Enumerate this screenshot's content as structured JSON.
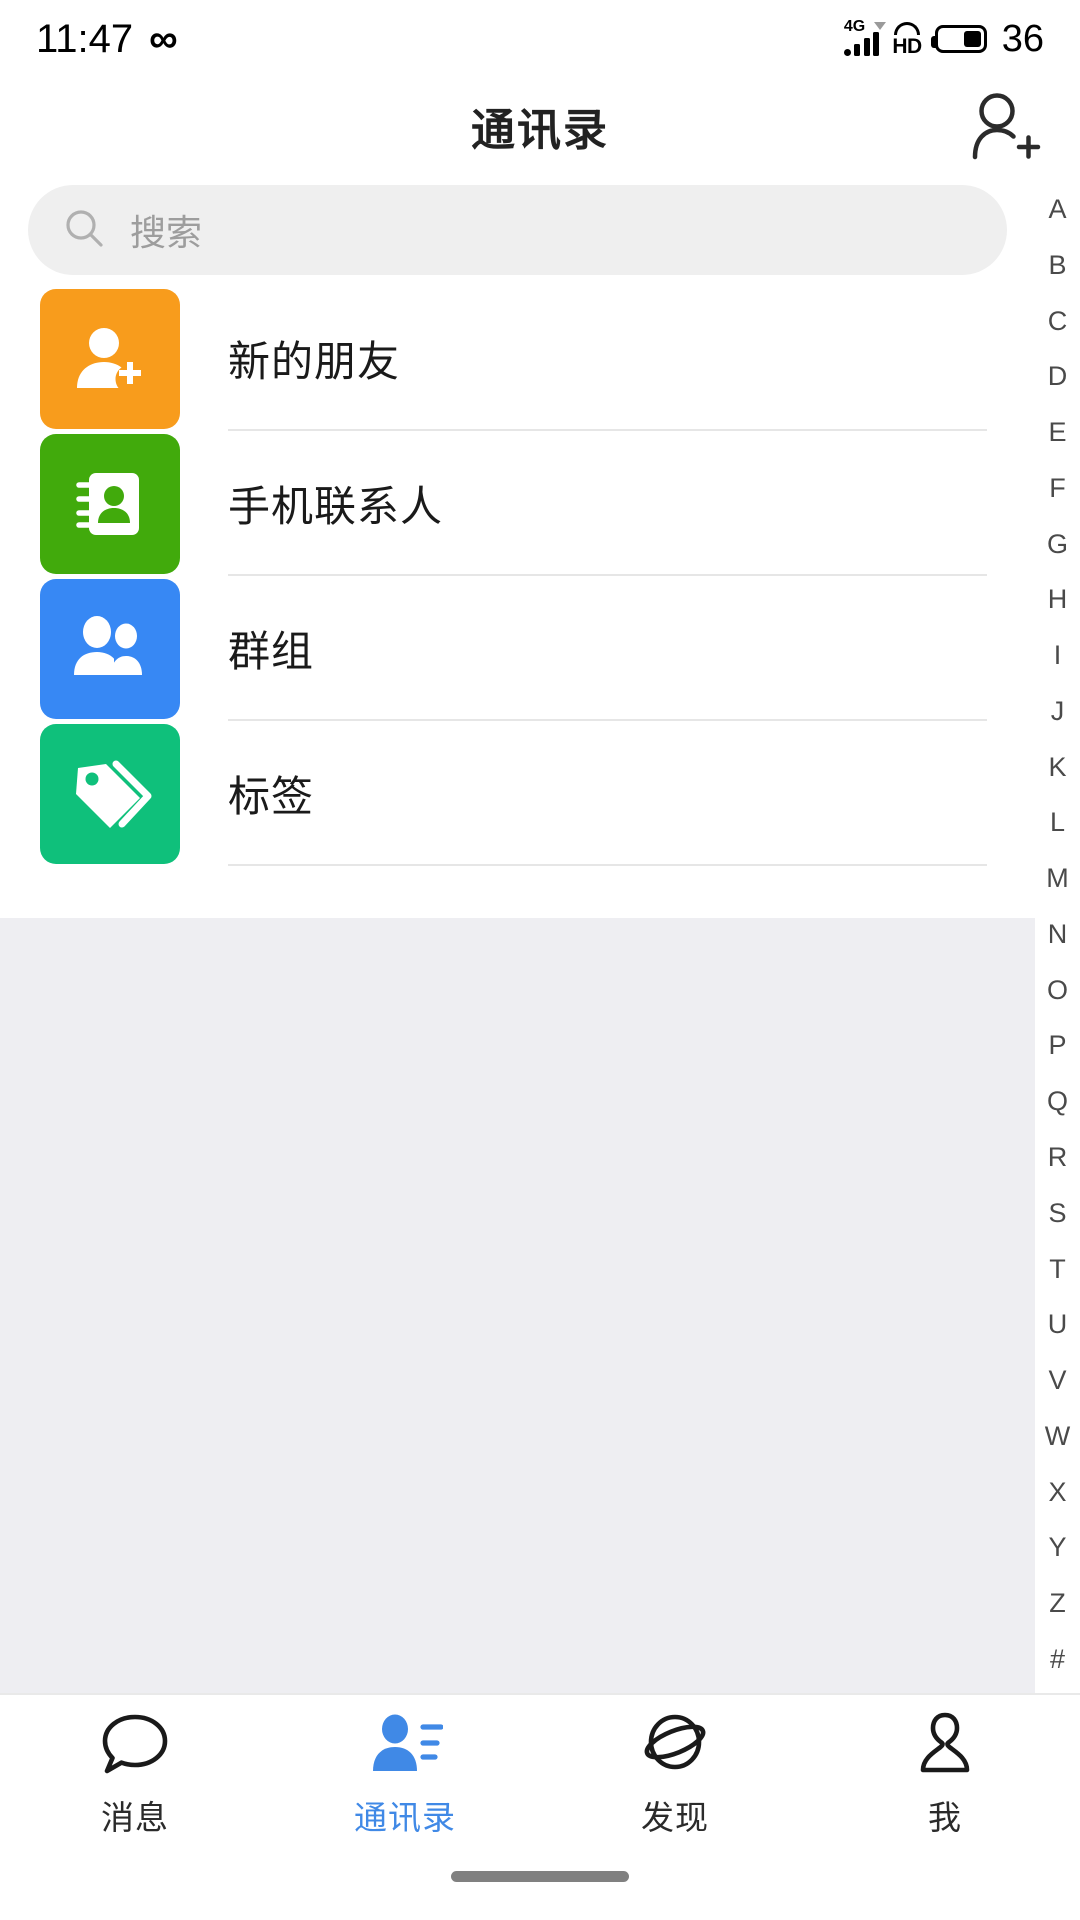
{
  "status_bar": {
    "time": "11:47",
    "infinity_icon": "infinity-icon",
    "network_type": "4G",
    "volte_label": "HD",
    "battery_percent": "36"
  },
  "header": {
    "title": "通讯录",
    "add_friend_icon": "add-person-icon"
  },
  "search": {
    "placeholder": "搜索",
    "value": "",
    "icon": "search-icon"
  },
  "list": {
    "items": [
      {
        "label": "新的朋友",
        "icon": "new-friend-icon",
        "color": "#F89C1C"
      },
      {
        "label": "手机联系人",
        "icon": "phone-contacts-icon",
        "color": "#41AA0C"
      },
      {
        "label": "群组",
        "icon": "groups-icon",
        "color": "#3788F4"
      },
      {
        "label": "标签",
        "icon": "tags-icon",
        "color": "#0FC07B"
      }
    ]
  },
  "alpha_index": {
    "letters": [
      "A",
      "B",
      "C",
      "D",
      "E",
      "F",
      "G",
      "H",
      "I",
      "J",
      "K",
      "L",
      "M",
      "N",
      "O",
      "P",
      "Q",
      "R",
      "S",
      "T",
      "U",
      "V",
      "W",
      "X",
      "Y",
      "Z",
      "#"
    ]
  },
  "tabbar": {
    "active_color": "#4089e6",
    "inactive_color": "#2b2b2b",
    "items": [
      {
        "label": "消息",
        "icon": "chat-bubble-icon",
        "active": false
      },
      {
        "label": "通讯录",
        "icon": "contacts-icon",
        "active": true
      },
      {
        "label": "发现",
        "icon": "discover-globe-icon",
        "active": false
      },
      {
        "label": "我",
        "icon": "profile-person-icon",
        "active": false
      }
    ]
  },
  "colors": {
    "page_background": "#ffffff",
    "empty_area": "#eeeef2",
    "search_field": "#efefef",
    "separator": "#e6e6e6",
    "accent_blue": "#4089e6"
  }
}
